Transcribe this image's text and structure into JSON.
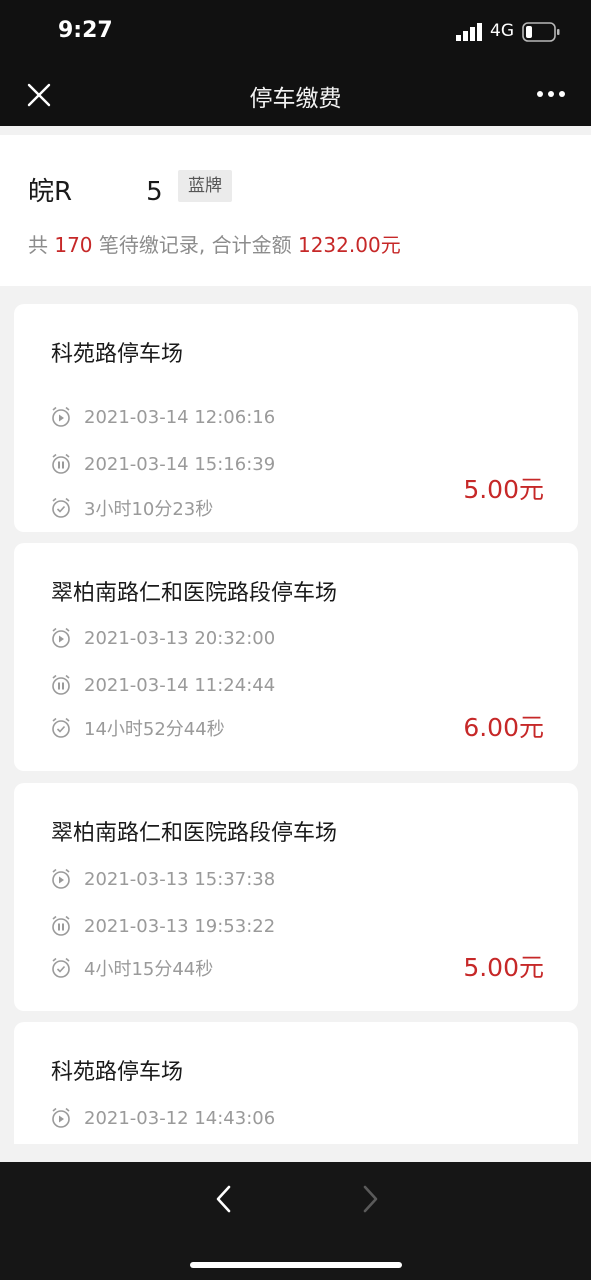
{
  "status_bar": {
    "time": "9:27",
    "network": "4G",
    "icons": [
      "signal-icon",
      "battery-icon"
    ]
  },
  "nav": {
    "title": "停车缴费",
    "icons": [
      "close-icon",
      "more-icon"
    ]
  },
  "summary": {
    "plate": "皖R",
    "plate_suffix": "5",
    "plate_type": "蓝牌",
    "prefix": "共",
    "count": "170",
    "middle": "笔待缴记录, 合计金额",
    "total": "1232.00元"
  },
  "records": [
    {
      "lot": "科苑路停车场",
      "start": "2021-03-14 12:06:16",
      "end": "2021-03-14 15:16:39",
      "duration": "3小时10分23秒",
      "amount": "5.00元"
    },
    {
      "lot": "翠柏南路仁和医院路段停车场",
      "start": "2021-03-13 20:32:00",
      "end": "2021-03-14 11:24:44",
      "duration": "14小时52分44秒",
      "amount": "6.00元"
    },
    {
      "lot": "翠柏南路仁和医院路段停车场",
      "start": "2021-03-13 15:37:38",
      "end": "2021-03-13 19:53:22",
      "duration": "4小时15分44秒",
      "amount": "5.00元"
    },
    {
      "lot": "科苑路停车场",
      "start": "2021-03-12 14:43:06"
    }
  ],
  "row_icons": [
    "start-clock-icon",
    "end-clock-icon",
    "duration-clock-icon"
  ],
  "colors": {
    "accent": "#c62828",
    "bar_background": "#111111",
    "page_background": "#f2f2f2"
  },
  "bottom_bar": {
    "icons": [
      "back-arrow-icon",
      "forward-arrow-icon"
    ]
  }
}
